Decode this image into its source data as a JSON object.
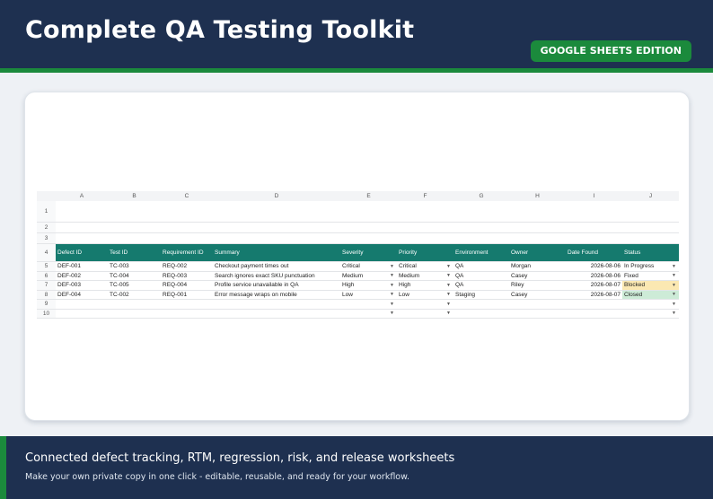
{
  "header": {
    "title": "Complete QA Testing Toolkit",
    "badge": "GOOGLE SHEETS EDITION"
  },
  "colors": {
    "navy": "#1e3050",
    "green": "#1b8a3c",
    "teal_header": "#157a6e",
    "blocked_fill": "#fbe8b2",
    "closed_fill": "#cdebd7"
  },
  "sheet": {
    "columns": [
      "A",
      "B",
      "C",
      "D",
      "E",
      "F",
      "G",
      "H",
      "I",
      "J"
    ],
    "row_numbers": [
      "1",
      "2",
      "3",
      "4",
      "5",
      "6",
      "7",
      "8",
      "9",
      "10"
    ],
    "headers": [
      "Defect ID",
      "Test ID",
      "Requirement ID",
      "Summary",
      "Severity",
      "Priority",
      "Environment",
      "Owner",
      "Date Found",
      "Status"
    ],
    "rows": [
      {
        "defect_id": "DEF-001",
        "test_id": "TC-003",
        "req_id": "REQ-002",
        "summary": "Checkout payment times out",
        "severity": "Critical",
        "priority": "Critical",
        "environment": "QA",
        "owner": "Morgan",
        "date_found": "2026-08-06",
        "status": "In Progress"
      },
      {
        "defect_id": "DEF-002",
        "test_id": "TC-004",
        "req_id": "REQ-003",
        "summary": "Search ignores exact SKU punctuation",
        "severity": "Medium",
        "priority": "Medium",
        "environment": "QA",
        "owner": "Casey",
        "date_found": "2026-08-06",
        "status": "Fixed"
      },
      {
        "defect_id": "DEF-003",
        "test_id": "TC-005",
        "req_id": "REQ-004",
        "summary": "Profile service unavailable in QA",
        "severity": "High",
        "priority": "High",
        "environment": "QA",
        "owner": "Riley",
        "date_found": "2026-08-07",
        "status": "Blocked"
      },
      {
        "defect_id": "DEF-004",
        "test_id": "TC-002",
        "req_id": "REQ-001",
        "summary": "Error message wraps on mobile",
        "severity": "Low",
        "priority": "Low",
        "environment": "Staging",
        "owner": "Casey",
        "date_found": "2026-08-07",
        "status": "Closed"
      }
    ]
  },
  "footer": {
    "headline": "Connected defect tracking, RTM, regression, risk, and release worksheets",
    "subline": "Make your own private copy in one click - editable, reusable, and ready for your workflow."
  }
}
